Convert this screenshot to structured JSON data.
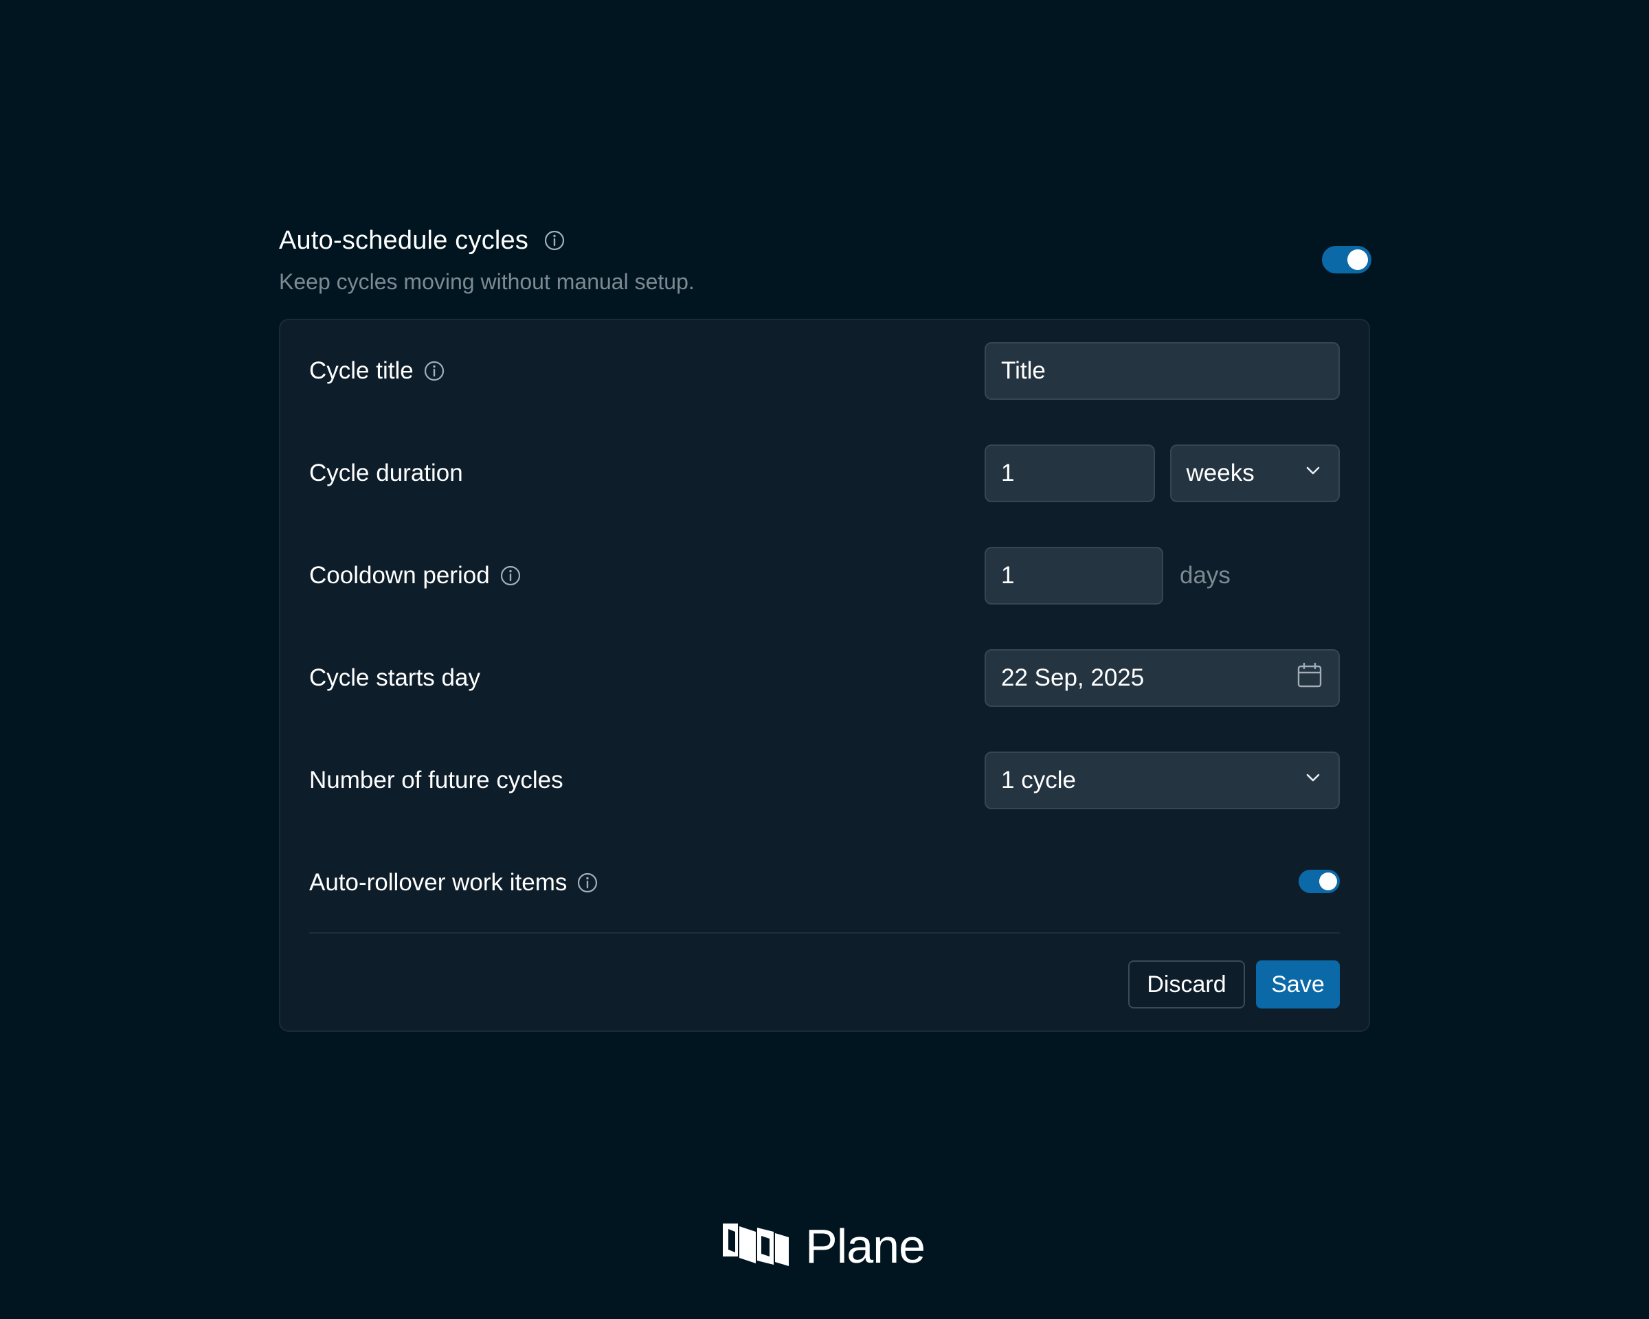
{
  "header": {
    "title": "Auto-schedule cycles",
    "subtitle": "Keep cycles moving without manual setup.",
    "toggle_on": true
  },
  "form": {
    "cycle_title": {
      "label": "Cycle title",
      "placeholder": "Title",
      "value": "Title"
    },
    "cycle_duration": {
      "label": "Cycle duration",
      "value": "1",
      "unit_selected": "weeks"
    },
    "cooldown_period": {
      "label": "Cooldown period",
      "value": "1",
      "unit": "days"
    },
    "cycle_starts_day": {
      "label": "Cycle starts day",
      "value": "22 Sep, 2025"
    },
    "future_cycles": {
      "label": "Number of future cycles",
      "selected": "1 cycle"
    },
    "auto_rollover": {
      "label": "Auto-rollover work items",
      "toggle_on": true
    }
  },
  "actions": {
    "discard_label": "Discard",
    "save_label": "Save"
  },
  "brand": {
    "name": "Plane",
    "accent": "#0b69a8",
    "background": "#011520"
  },
  "icons": {
    "info": "info-icon",
    "chevron": "chevron-down-icon",
    "calendar": "calendar-icon",
    "logo": "plane-logo-icon"
  }
}
